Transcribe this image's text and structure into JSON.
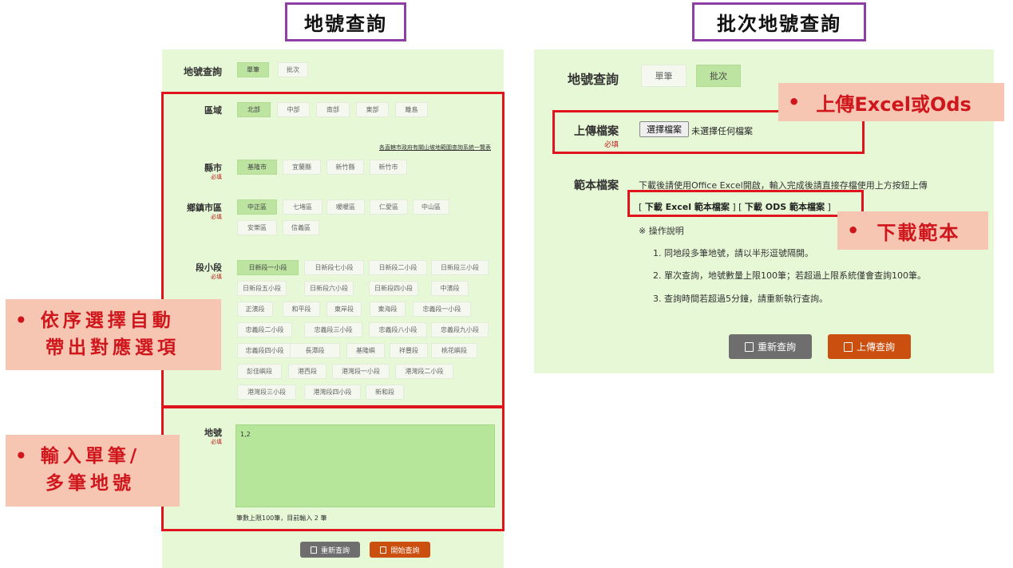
{
  "titles": {
    "single": "地號查詢",
    "batch": "批次地號查詢"
  },
  "left": {
    "header_label": "地號查詢",
    "mode_tabs": [
      "單筆",
      "批次"
    ],
    "region_label": "區域",
    "regions": [
      "北部",
      "中部",
      "南部",
      "東部",
      "離島"
    ],
    "notice_link": "各直轄市政府有關山坡地範圍查詢系統一覽表",
    "county_label": "縣市",
    "required": "必填",
    "counties": [
      "基隆市",
      "宜蘭縣",
      "新竹縣",
      "新竹市"
    ],
    "town_label": "鄉鎮市區",
    "towns": [
      "中正區",
      "七堵區",
      "暖暖區",
      "仁愛區",
      "中山區",
      "安樂區",
      "信義區"
    ],
    "section_label": "段小段",
    "sections": [
      "日新段一小段",
      "日新段七小段",
      "日新段二小段",
      "日新段三小段",
      "日新段五小段",
      "日新段六小段",
      "日新段四小段",
      "中濱段",
      "正濱段",
      "和平段",
      "東岸段",
      "東海段",
      "忠義段一小段",
      "忠義段二小段",
      "忠義段三小段",
      "忠義段八小段",
      "忠義段九小段",
      "忠義段四小段",
      "長潭段",
      "基隆嶼",
      "祥豐段",
      "桃花嶼段",
      "彭佳嶼段",
      "港西段",
      "港灣段一小段",
      "港灣段二小段",
      "港灣段三小段",
      "港灣段四小段",
      "新和段"
    ],
    "parcel_label": "地號",
    "parcel_value": "1,2",
    "parcel_hint": "筆數上限100筆，目前輸入 2 筆",
    "reset_button": "重新查詢",
    "start_button": "開始查詢"
  },
  "right": {
    "header_label": "地號查詢",
    "mode_tabs": [
      "單筆",
      "批次"
    ],
    "upload_label": "上傳檔案",
    "required": "必填",
    "choose_file_button": "選擇檔案",
    "no_file_text": "未選擇任何檔案",
    "template_label": "範本檔案",
    "template_desc": "下載後請使用Office Excel開啟，輸入完成後請直接存檔使用上方按鈕上傳",
    "download_excel": "下載 Excel 範本檔案",
    "download_ods": "下載 ODS 範本檔案",
    "instructions_title": "※ 操作說明",
    "instructions": [
      "1. 同地段多筆地號，請以半形逗號隔開。",
      "2. 單次查詢，地號數量上限100筆；若超過上限系統僅會查詢100筆。",
      "3. 查詢時間若超過5分鐘，請重新執行查詢。"
    ],
    "reset_button": "重新查詢",
    "upload_query_button": "上傳查詢"
  },
  "callouts": {
    "auto_select_line1": "依序選擇自動",
    "auto_select_line2": "帶出對應選項",
    "input_line1": "輸入單筆/",
    "input_line2": "多筆地號",
    "upload": "上傳Excel或Ods",
    "download": "下載範本",
    "bullet": "•"
  },
  "colors": {
    "panel": "#e7f8d6",
    "selected_chip": "#bde5a1",
    "frame_red": "#e0141c",
    "callout_bg": "#f7c6b2",
    "title_border": "#8e3fa5",
    "button_gray": "#6e6e6e",
    "button_orange": "#cb4f0f"
  }
}
